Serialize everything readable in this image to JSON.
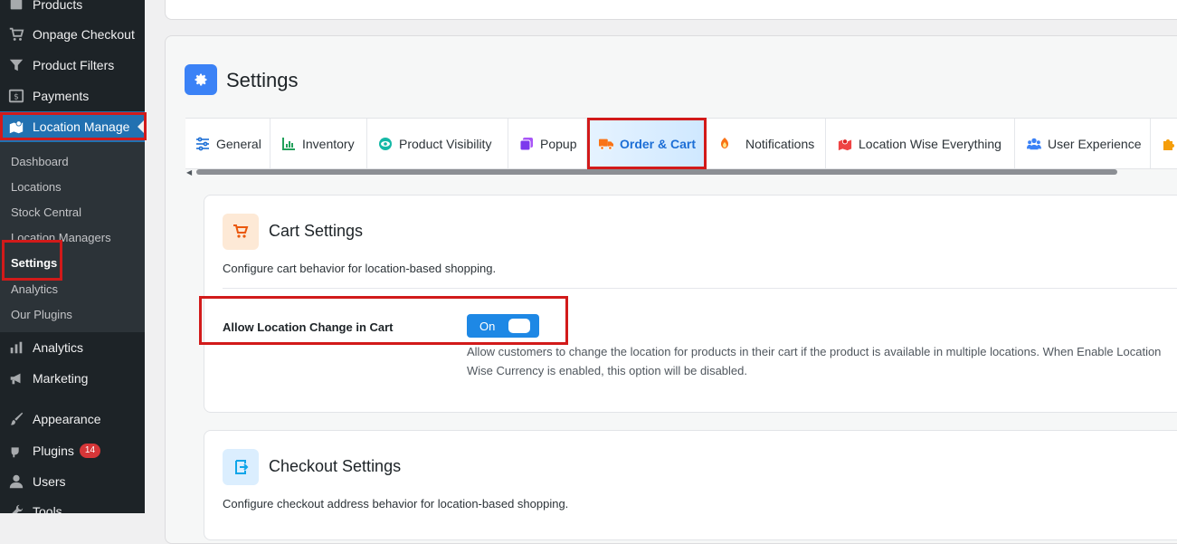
{
  "sidebar": {
    "menu": [
      {
        "label": "Products",
        "icon": "products-icon"
      },
      {
        "label": "Onpage Checkout",
        "icon": "cart-icon"
      },
      {
        "label": "Product Filters",
        "icon": "filter-icon"
      },
      {
        "label": "Payments",
        "icon": "payments-icon"
      },
      {
        "label": "Location Manage",
        "icon": "location-icon"
      }
    ],
    "submenu": [
      "Dashboard",
      "Locations",
      "Stock Central",
      "Location Managers",
      "Settings",
      "Analytics",
      "Our Plugins"
    ],
    "menu_bottom": [
      {
        "label": "Analytics",
        "icon": "bar-chart-icon"
      },
      {
        "label": "Marketing",
        "icon": "megaphone-icon"
      },
      {
        "label": "Appearance",
        "icon": "brush-icon"
      },
      {
        "label": "Plugins",
        "icon": "plug-icon",
        "badge": "14"
      },
      {
        "label": "Users",
        "icon": "user-icon"
      },
      {
        "label": "Tools",
        "icon": "wrench-icon"
      }
    ]
  },
  "page": {
    "title": "Settings"
  },
  "tabs": [
    {
      "label": "General",
      "icon": "sliders-icon"
    },
    {
      "label": "Inventory",
      "icon": "inventory-icon"
    },
    {
      "label": "Product Visibility",
      "icon": "eye-icon"
    },
    {
      "label": "Popup",
      "icon": "popup-icon"
    },
    {
      "label": "Order & Cart",
      "icon": "truck-icon"
    },
    {
      "label": "Notifications",
      "icon": "bell-icon"
    },
    {
      "label": "Location Wise Everything",
      "icon": "map-icon"
    },
    {
      "label": "User Experience",
      "icon": "users-icon"
    }
  ],
  "active_tab": "Order & Cart",
  "cart_settings": {
    "title": "Cart Settings",
    "description": "Configure cart behavior for location-based shopping.",
    "option_label": "Allow Location Change in Cart",
    "toggle_label": "On",
    "help_text": "Allow customers to change the location for products in their cart if the product is available in multiple locations. When Enable Location Wise Currency is enabled, this option will be disabled."
  },
  "checkout_settings": {
    "title": "Checkout Settings",
    "description": "Configure checkout address behavior for location-based shopping."
  },
  "colors": {
    "sidebar_bg": "#1d2327",
    "accent": "#2271b1",
    "toggle_on": "#1e88e5",
    "highlight_box": "#d21a1a"
  }
}
